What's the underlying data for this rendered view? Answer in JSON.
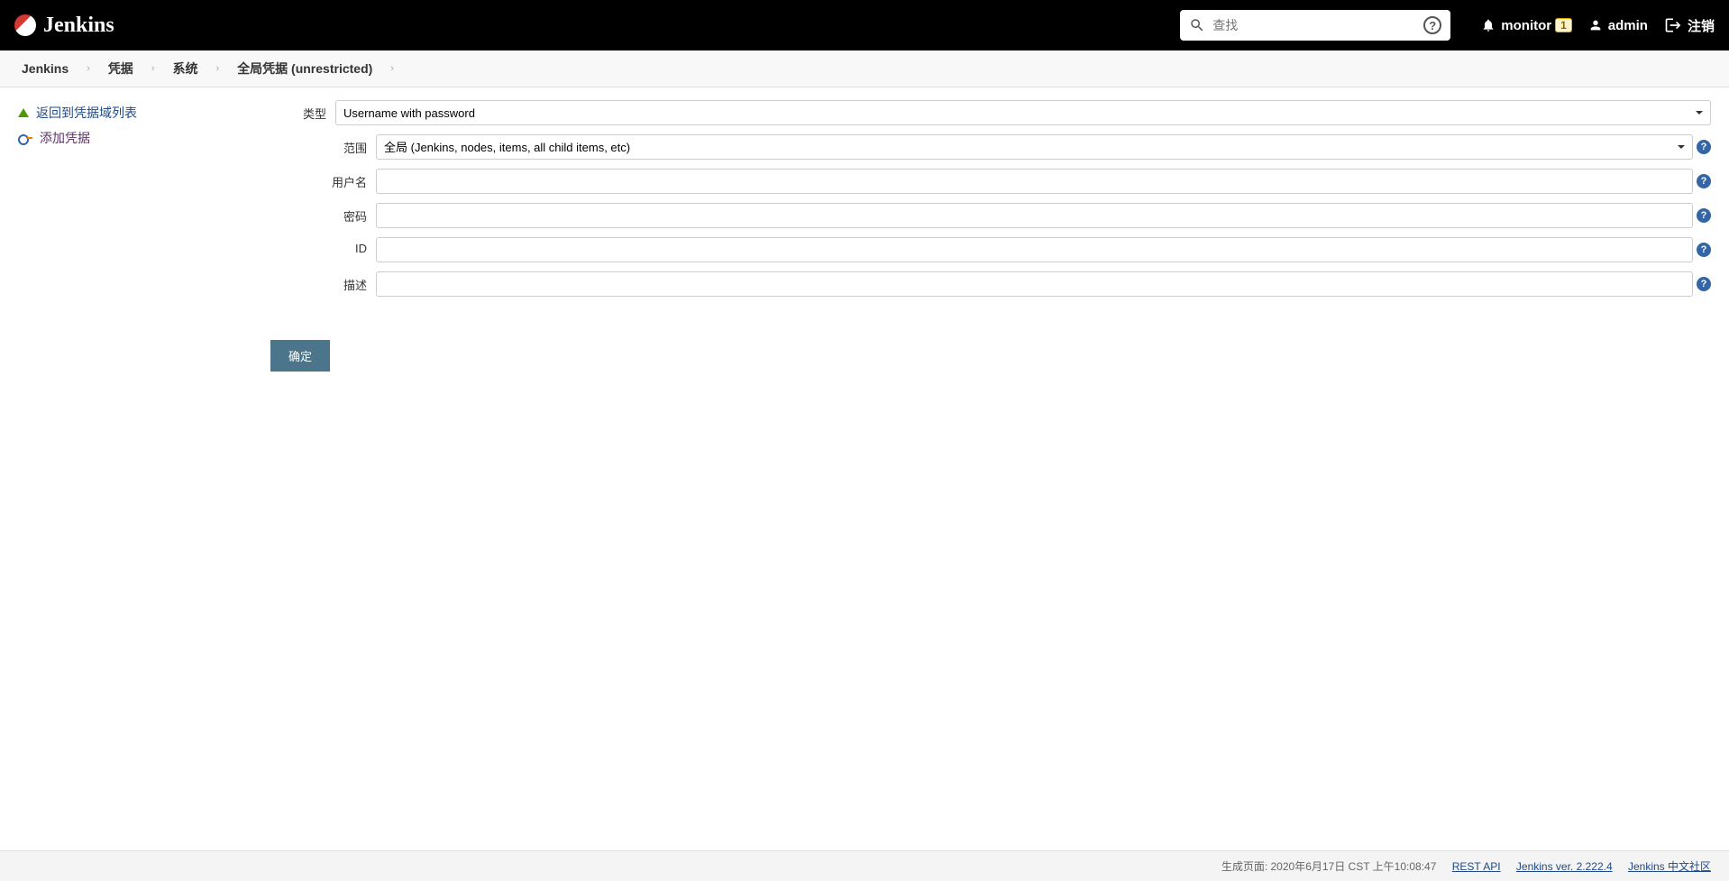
{
  "header": {
    "logo_text": "Jenkins",
    "search_placeholder": "查找",
    "monitor_label": "monitor",
    "monitor_badge": "1",
    "user_label": "admin",
    "logout_label": "注销"
  },
  "breadcrumbs": [
    "Jenkins",
    "凭据",
    "系统",
    "全局凭据 (unrestricted)"
  ],
  "sidebar": {
    "back_label": "返回到凭据域列表",
    "add_label": "添加凭据"
  },
  "form": {
    "type": {
      "label": "类型",
      "value": "Username with password"
    },
    "scope": {
      "label": "范围",
      "value": "全局 (Jenkins, nodes, items, all child items, etc)"
    },
    "username": {
      "label": "用户名",
      "value": ""
    },
    "password": {
      "label": "密码",
      "value": ""
    },
    "id": {
      "label": "ID",
      "value": ""
    },
    "description": {
      "label": "描述",
      "value": ""
    },
    "submit": "确定"
  },
  "footer": {
    "generated": "生成页面: 2020年6月17日 CST 上午10:08:47",
    "rest_api": "REST API",
    "version": "Jenkins ver. 2.222.4",
    "community": "Jenkins 中文社区"
  }
}
